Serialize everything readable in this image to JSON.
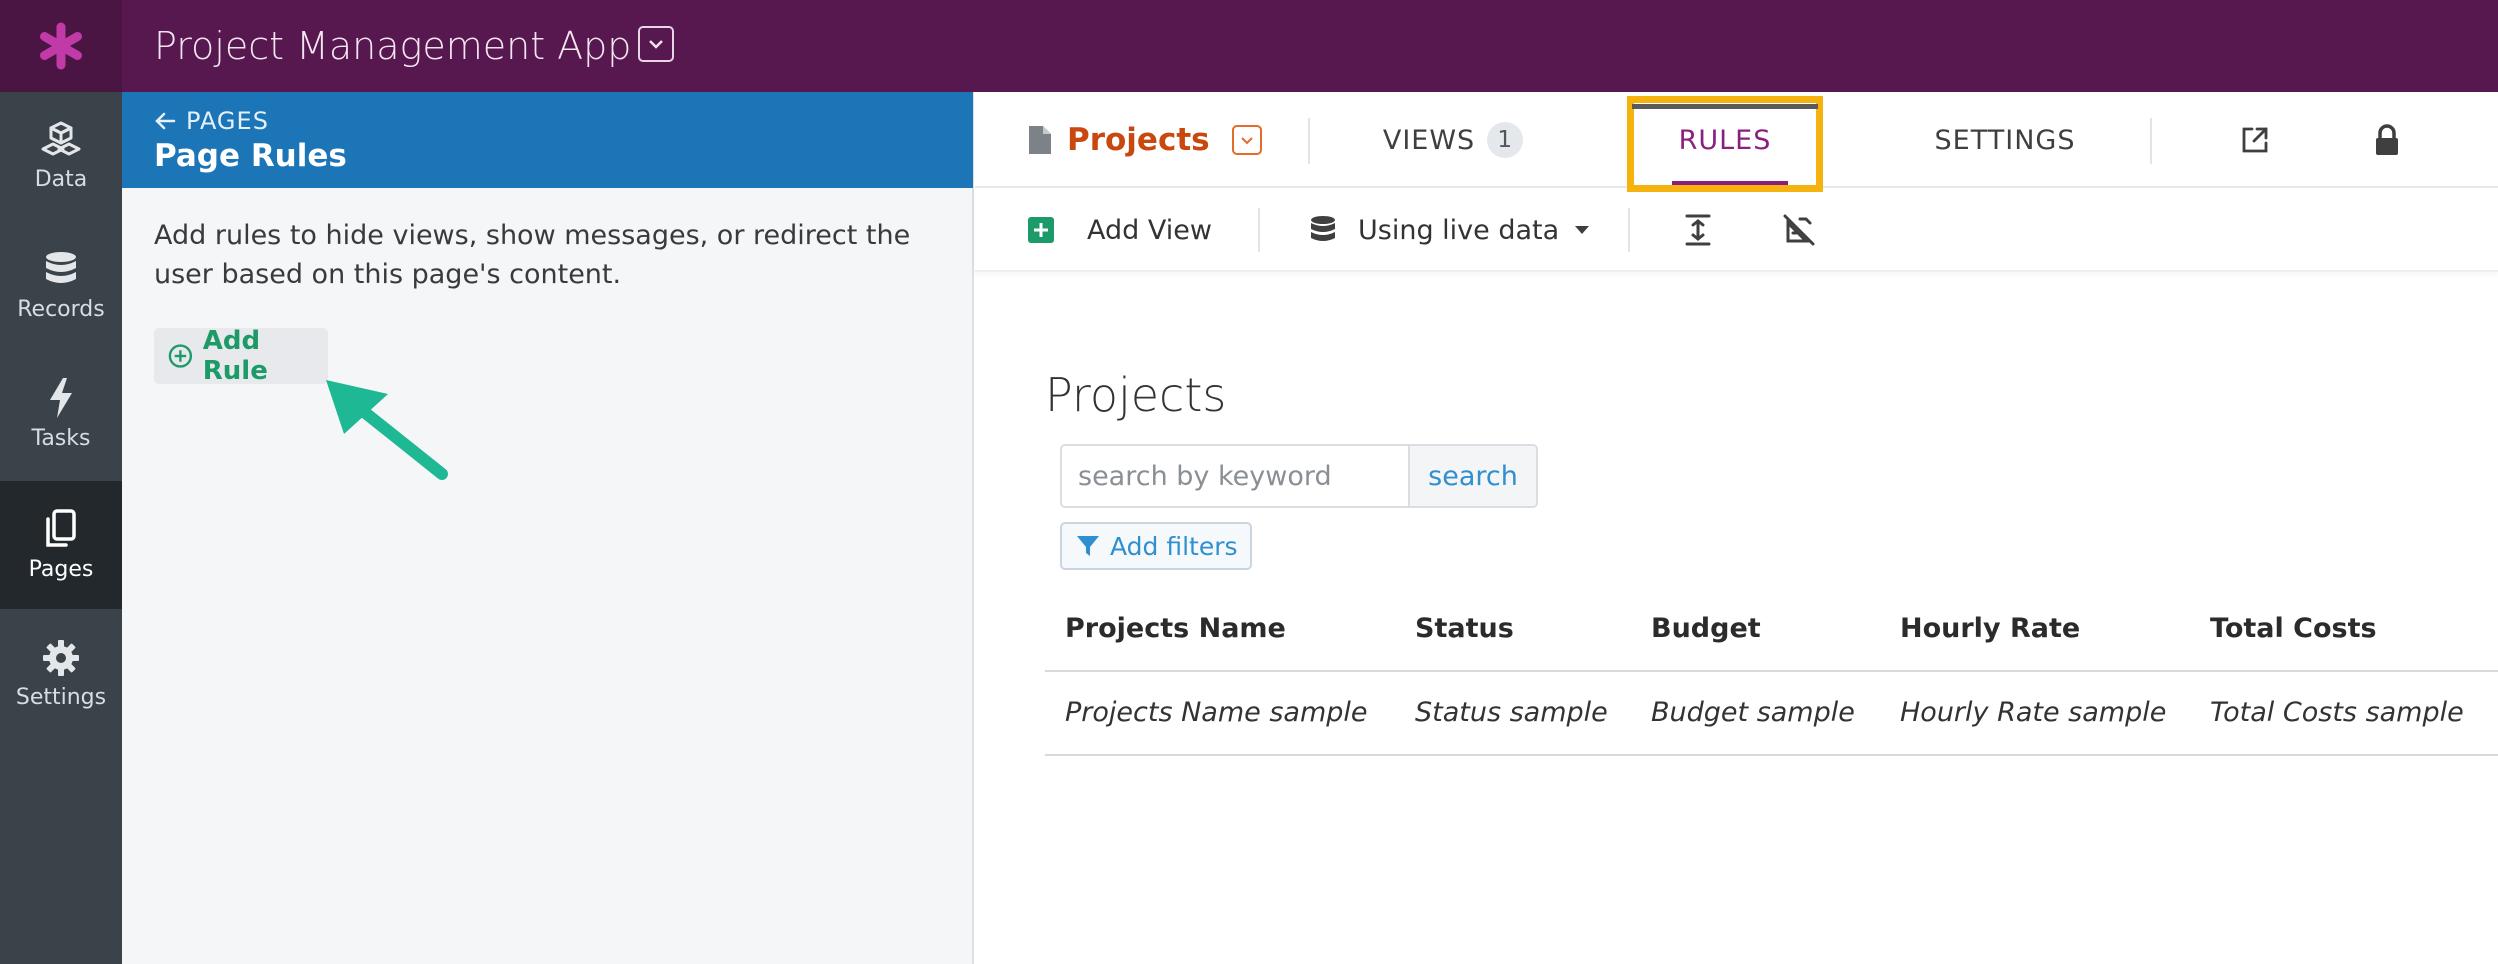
{
  "app": {
    "title": "Project Management App"
  },
  "nav": {
    "items": [
      {
        "label": "Data",
        "icon": "cubes-icon"
      },
      {
        "label": "Records",
        "icon": "database-icon"
      },
      {
        "label": "Tasks",
        "icon": "bolt-icon"
      },
      {
        "label": "Pages",
        "icon": "pages-icon",
        "active": true
      },
      {
        "label": "Settings",
        "icon": "gear-icon"
      }
    ]
  },
  "panel": {
    "back_label": "PAGES",
    "title": "Page Rules",
    "description": "Add rules to hide views, show messages, or redirect the user based on this page's content.",
    "add_rule_label": "Add Rule"
  },
  "tabs": {
    "page_name": "Projects",
    "views_label": "VIEWS",
    "views_count": "1",
    "rules_label": "RULES",
    "settings_label": "SETTINGS",
    "active": "RULES"
  },
  "toolbar": {
    "add_view_label": "Add View",
    "live_data_label": "Using live data"
  },
  "view": {
    "title": "Projects",
    "search_placeholder": "search by keyword",
    "search_button": "search",
    "filters_label": "Add filters",
    "columns": [
      "Projects Name",
      "Status",
      "Budget",
      "Hourly Rate",
      "Total Costs"
    ],
    "rows": [
      [
        "Projects Name sample",
        "Status sample",
        "Budget sample",
        "Hourly Rate sample",
        "Total Costs sample"
      ]
    ]
  },
  "colors": {
    "topbar": "#57174f",
    "panel_header": "#1b75b7",
    "accent_green": "#1c9a67",
    "page_orange": "#c9480f",
    "rules_purple": "#8a1f7d",
    "highlight": "#f6b30f",
    "arrow": "#1fb894"
  }
}
